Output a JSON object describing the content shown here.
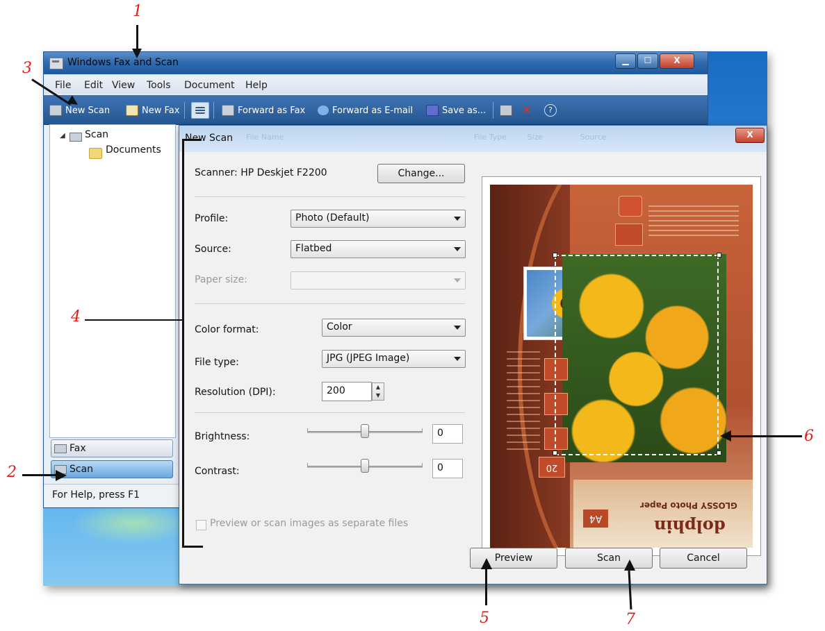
{
  "window": {
    "title": "Windows Fax and Scan",
    "caption_buttons": {
      "minimize": "▁",
      "maximize": "☐",
      "close": "X"
    }
  },
  "menu": [
    "File",
    "Edit",
    "View",
    "Tools",
    "Document",
    "Help"
  ],
  "toolbar": {
    "new_scan": "New Scan",
    "new_fax": "New Fax",
    "forward_fax": "Forward as Fax",
    "forward_email": "Forward as E-mail",
    "save_as": "Save as..."
  },
  "nav": {
    "tree_root": "Scan",
    "tree_child": "Documents",
    "fax_button": "Fax",
    "scan_button": "Scan"
  },
  "status": "For Help, press F1",
  "dialog": {
    "title": "New Scan",
    "title_behind": [
      "File Name",
      "File Type",
      "Size",
      "Source"
    ],
    "close": "X",
    "scanner_label": "Scanner: HP Deskjet F2200",
    "change_button": "Change...",
    "profile_label": "Profile:",
    "profile_value": "Photo (Default)",
    "source_label": "Source:",
    "source_value": "Flatbed",
    "paper_size_label": "Paper size:",
    "paper_size_value": "",
    "color_format_label": "Color format:",
    "color_format_value": "Color",
    "file_type_label": "File type:",
    "file_type_value": "JPG (JPEG Image)",
    "resolution_label": "Resolution (DPI):",
    "resolution_value": "200",
    "brightness_label": "Brightness:",
    "brightness_value": "0",
    "contrast_label": "Contrast:",
    "contrast_value": "0",
    "separate_files_label": "Preview or scan images as separate files",
    "separate_files_checked": false,
    "preview_button": "Preview",
    "scan_button": "Scan",
    "cancel_button": "Cancel"
  },
  "preview_image": {
    "upside_down_text": {
      "brand": "dolphin",
      "product": "GLOSSY Photo Paper",
      "size": "A4",
      "count": "20"
    },
    "colors": {
      "background": "#6b2a1a",
      "flowers": "#f0b81c",
      "leaves": "#2f5a1c",
      "paper": "#e8dcc8"
    }
  },
  "annotations": [
    "1",
    "2",
    "3",
    "4",
    "5",
    "6",
    "7"
  ],
  "colors": {
    "titlebar": "#2e68ad",
    "toolbar": "#24568f",
    "annotation": "#e21b1b",
    "dialog_bg": "#f1f1f1"
  }
}
